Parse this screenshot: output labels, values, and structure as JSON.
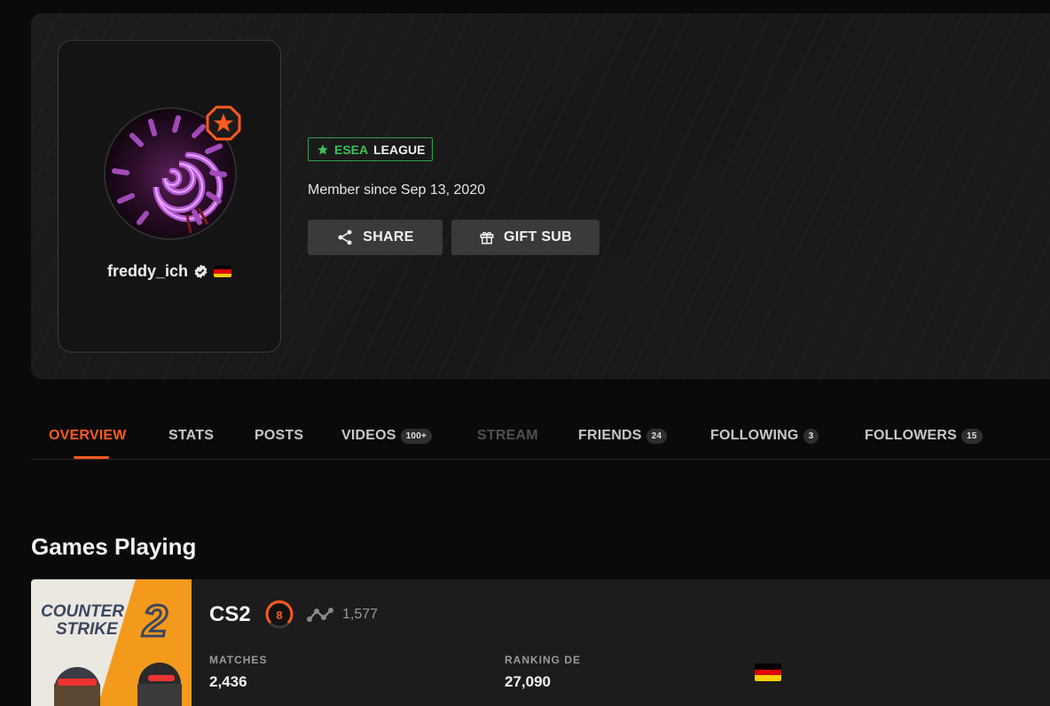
{
  "profile": {
    "username": "freddy_ich",
    "member_since": "Member since Sep 13, 2020",
    "league_badge": {
      "part1": "ESEA",
      "part2": "LEAGUE"
    },
    "buttons": {
      "share": "SHARE",
      "gift_sub": "GIFT SUB"
    },
    "country": "Germany"
  },
  "tabs": [
    {
      "label": "OVERVIEW",
      "count": "",
      "active": true
    },
    {
      "label": "STATS",
      "count": ""
    },
    {
      "label": "POSTS",
      "count": ""
    },
    {
      "label": "VIDEOS",
      "count": "100+"
    },
    {
      "label": "STREAM",
      "count": "",
      "disabled": true
    },
    {
      "label": "FRIENDS",
      "count": "24"
    },
    {
      "label": "FOLLOWING",
      "count": "3"
    },
    {
      "label": "FOLLOWERS",
      "count": "15"
    }
  ],
  "games_section": {
    "title": "Games Playing",
    "game": {
      "art_text_line1": "COUNTER",
      "art_text_line2": "STRIKE",
      "art_number": "2",
      "name": "CS2",
      "skill_level": "8",
      "elo": "1,577",
      "matches_label": "MATCHES",
      "matches_value": "2,436",
      "ranking_label": "RANKING DE",
      "ranking_value": "27,090"
    }
  },
  "colors": {
    "accent": "#ff5a1f",
    "esea_green": "#3fbf5a",
    "background": "#0a0a0a",
    "card": "#1c1c1c"
  }
}
